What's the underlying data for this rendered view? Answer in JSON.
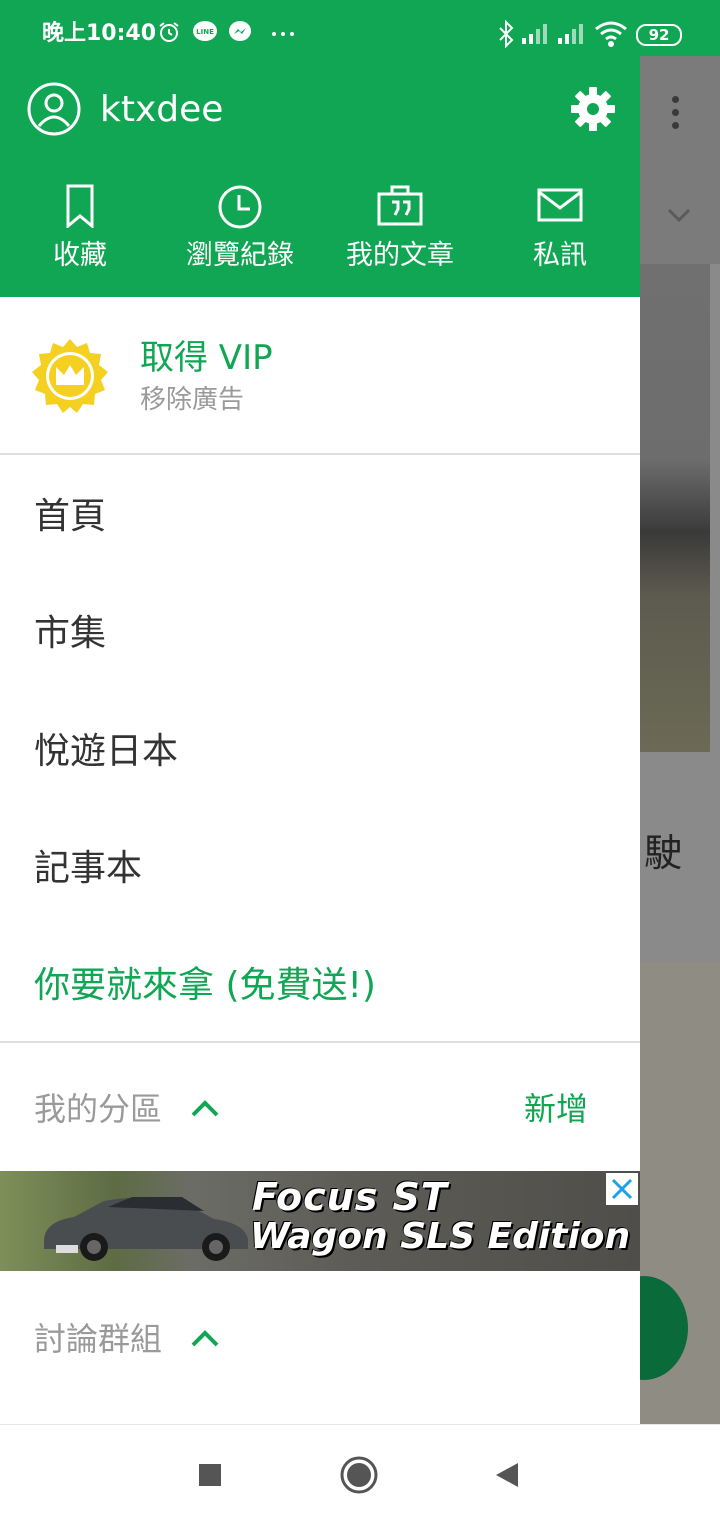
{
  "status_bar": {
    "time": "晚上10:40",
    "icons": [
      "alarm-icon",
      "line-icon",
      "messenger-icon",
      "more-dots-icon",
      "bluetooth-icon",
      "signal-icon",
      "signal-icon",
      "wifi-icon"
    ],
    "battery": "92"
  },
  "drawer": {
    "username": "ktxdee",
    "quick_actions": [
      {
        "label": "收藏",
        "icon": "bookmark-icon"
      },
      {
        "label": "瀏覽紀錄",
        "icon": "clock-icon"
      },
      {
        "label": "我的文章",
        "icon": "article-quote-icon"
      },
      {
        "label": "私訊",
        "icon": "mail-icon"
      }
    ],
    "vip": {
      "title": "取得 VIP",
      "subtitle": "移除廣告"
    },
    "menu": [
      {
        "label": "首頁"
      },
      {
        "label": "市集"
      },
      {
        "label": "悅遊日本"
      },
      {
        "label": "記事本"
      },
      {
        "label": "你要就來拿 (免費送!)"
      }
    ],
    "sections": {
      "my_boards": {
        "label": "我的分區",
        "action": "新增"
      },
      "groups": {
        "label": "討論群組"
      }
    },
    "ad": {
      "line1": "Focus ST",
      "line2": "Wagon SLS Edition"
    }
  },
  "background": {
    "visible_char": "駛"
  },
  "colors": {
    "brand_green": "#10a653",
    "vip_gold": "#f5d021",
    "text_dark": "#333333",
    "text_muted": "#9a9a9a"
  }
}
